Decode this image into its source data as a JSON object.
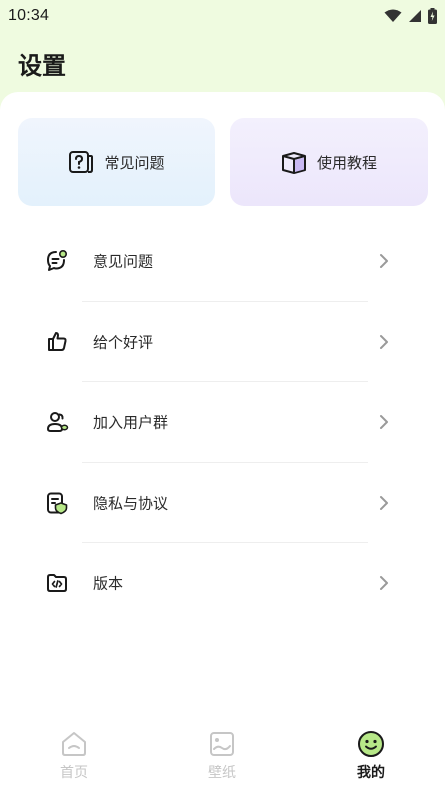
{
  "status_bar": {
    "time": "10:34"
  },
  "page": {
    "title": "设置"
  },
  "quick_cards": [
    {
      "label": "常见问题",
      "icon": "question-book-icon"
    },
    {
      "label": "使用教程",
      "icon": "open-book-icon"
    }
  ],
  "menu": [
    {
      "label": "意见问题",
      "icon": "chat-bubble-icon"
    },
    {
      "label": "给个好评",
      "icon": "thumbs-up-icon"
    },
    {
      "label": "加入用户群",
      "icon": "user-group-icon"
    },
    {
      "label": "隐私与协议",
      "icon": "shield-document-icon"
    },
    {
      "label": "版本",
      "icon": "code-folder-icon"
    }
  ],
  "bottom_nav": [
    {
      "label": "首页",
      "icon": "home-icon",
      "active": false
    },
    {
      "label": "壁纸",
      "icon": "wallpaper-icon",
      "active": false
    },
    {
      "label": "我的",
      "icon": "smiley-icon",
      "active": true
    }
  ],
  "colors": {
    "header_bg": "#effbe0",
    "faq_card": "#e3f1fc",
    "tutorial_card": "#ece6fb",
    "accent_green": "#b7e888"
  }
}
